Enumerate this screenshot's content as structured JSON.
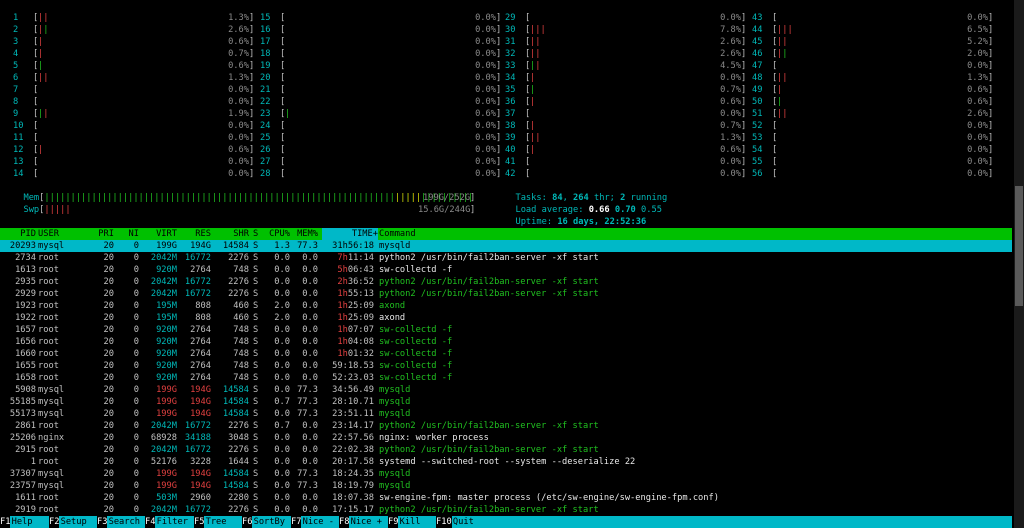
{
  "cpus": [
    {
      "n": "1",
      "bars": [
        [
          "r",
          "||"
        ]
      ],
      "pct": "1.3%"
    },
    {
      "n": "2",
      "bars": [
        [
          "r",
          "|"
        ],
        [
          "g",
          "|"
        ]
      ],
      "pct": "2.6%"
    },
    {
      "n": "3",
      "bars": [
        [
          "r",
          "|"
        ]
      ],
      "pct": "0.6%"
    },
    {
      "n": "4",
      "bars": [
        [
          "r",
          "|"
        ]
      ],
      "pct": "0.7%"
    },
    {
      "n": "5",
      "bars": [
        [
          "g",
          "|"
        ]
      ],
      "pct": "0.6%"
    },
    {
      "n": "6",
      "bars": [
        [
          "r",
          "||"
        ]
      ],
      "pct": "1.3%"
    },
    {
      "n": "7",
      "bars": [],
      "pct": "0.0%"
    },
    {
      "n": "8",
      "bars": [],
      "pct": "0.0%"
    },
    {
      "n": "9",
      "bars": [
        [
          "g",
          "|"
        ],
        [
          "r",
          "|"
        ]
      ],
      "pct": "1.9%"
    },
    {
      "n": "10",
      "bars": [],
      "pct": "0.0%"
    },
    {
      "n": "11",
      "bars": [],
      "pct": "0.0%"
    },
    {
      "n": "12",
      "bars": [
        [
          "r",
          "|"
        ]
      ],
      "pct": "0.6%"
    },
    {
      "n": "13",
      "bars": [],
      "pct": "0.0%"
    },
    {
      "n": "14",
      "bars": [],
      "pct": "0.0%"
    },
    {
      "n": "15",
      "bars": [],
      "pct": "0.0%"
    },
    {
      "n": "16",
      "bars": [],
      "pct": "0.0%"
    },
    {
      "n": "17",
      "bars": [],
      "pct": "0.0%"
    },
    {
      "n": "18",
      "bars": [],
      "pct": "0.0%"
    },
    {
      "n": "19",
      "bars": [],
      "pct": "0.0%"
    },
    {
      "n": "20",
      "bars": [],
      "pct": "0.0%"
    },
    {
      "n": "21",
      "bars": [],
      "pct": "0.0%"
    },
    {
      "n": "22",
      "bars": [],
      "pct": "0.0%"
    },
    {
      "n": "23",
      "bars": [
        [
          "g",
          "|"
        ]
      ],
      "pct": "0.6%"
    },
    {
      "n": "24",
      "bars": [],
      "pct": "0.0%"
    },
    {
      "n": "25",
      "bars": [],
      "pct": "0.0%"
    },
    {
      "n": "26",
      "bars": [],
      "pct": "0.0%"
    },
    {
      "n": "27",
      "bars": [],
      "pct": "0.0%"
    },
    {
      "n": "28",
      "bars": [],
      "pct": "0.0%"
    },
    {
      "n": "29",
      "bars": [],
      "pct": "0.0%"
    },
    {
      "n": "30",
      "bars": [
        [
          "r",
          "|||"
        ]
      ],
      "pct": "7.8%"
    },
    {
      "n": "31",
      "bars": [
        [
          "r",
          "||"
        ]
      ],
      "pct": "2.6%"
    },
    {
      "n": "32",
      "bars": [
        [
          "r",
          "||"
        ]
      ],
      "pct": "2.6%"
    },
    {
      "n": "33",
      "bars": [
        [
          "g",
          "|"
        ],
        [
          "r",
          "|"
        ]
      ],
      "pct": "4.5%"
    },
    {
      "n": "34",
      "bars": [
        [
          "r",
          "|"
        ]
      ],
      "pct": "0.0%"
    },
    {
      "n": "35",
      "bars": [
        [
          "g",
          "|"
        ]
      ],
      "pct": "0.7%"
    },
    {
      "n": "36",
      "bars": [
        [
          "r",
          "|"
        ]
      ],
      "pct": "0.6%"
    },
    {
      "n": "37",
      "bars": [],
      "pct": "0.0%"
    },
    {
      "n": "38",
      "bars": [
        [
          "r",
          "|"
        ]
      ],
      "pct": "0.7%"
    },
    {
      "n": "39",
      "bars": [
        [
          "r",
          "||"
        ]
      ],
      "pct": "1.3%"
    },
    {
      "n": "40",
      "bars": [
        [
          "r",
          "|"
        ]
      ],
      "pct": "0.6%"
    },
    {
      "n": "41",
      "bars": [],
      "pct": "0.0%"
    },
    {
      "n": "42",
      "bars": [],
      "pct": "0.0%"
    },
    {
      "n": "43",
      "bars": [],
      "pct": "0.0%"
    },
    {
      "n": "44",
      "bars": [
        [
          "r",
          "|||"
        ]
      ],
      "pct": "6.5%"
    },
    {
      "n": "45",
      "bars": [
        [
          "r",
          "||"
        ]
      ],
      "pct": "5.2%"
    },
    {
      "n": "46",
      "bars": [
        [
          "r",
          "|"
        ],
        [
          "g",
          "|"
        ]
      ],
      "pct": "2.0%"
    },
    {
      "n": "47",
      "bars": [],
      "pct": "0.0%"
    },
    {
      "n": "48",
      "bars": [
        [
          "r",
          "||"
        ]
      ],
      "pct": "1.3%"
    },
    {
      "n": "49",
      "bars": [
        [
          "r",
          "|"
        ]
      ],
      "pct": "0.6%"
    },
    {
      "n": "50",
      "bars": [
        [
          "g",
          "|"
        ]
      ],
      "pct": "0.6%"
    },
    {
      "n": "51",
      "bars": [
        [
          "r",
          "||"
        ]
      ],
      "pct": "2.6%"
    },
    {
      "n": "52",
      "bars": [],
      "pct": "0.0%"
    },
    {
      "n": "53",
      "bars": [],
      "pct": "0.0%"
    },
    {
      "n": "54",
      "bars": [],
      "pct": "0.0%"
    },
    {
      "n": "55",
      "bars": [],
      "pct": "0.0%"
    },
    {
      "n": "56",
      "bars": [],
      "pct": "0.0%"
    }
  ],
  "memory": {
    "mem_label": "Mem",
    "mem_bar": "||||||||||||||||||||||||||||||||||||||||||||||||||||||||||||||||||||||||||||||||||",
    "mem_tail": "|||||",
    "mem_value": "199G/252G",
    "swp_label": "Swp",
    "swp_bar": "|||||",
    "swp_value": "15.6G/244G"
  },
  "summary": {
    "tasks_label": "Tasks: ",
    "tasks_count": "84",
    "thr_sep": ", ",
    "thr_count": "264",
    "thr_label": " thr; ",
    "running_count": "2",
    "running_label": " running",
    "load_label": "Load average: ",
    "load1": "0.66",
    "load5": "0.70",
    "load15": "0.55",
    "uptime_label": "Uptime: ",
    "uptime": "16 days, 22:52:36"
  },
  "header": {
    "pid": "PID",
    "user": "USER",
    "pri": "PRI",
    "ni": "NI",
    "virt": "VIRT",
    "res": "RES",
    "shr": "SHR",
    "s": "S",
    "cpu": "CPU%",
    "mem": "MEM%",
    "time": "TIME+",
    "cmd": "Command"
  },
  "processes": [
    {
      "pid": "20293",
      "user": "mysql",
      "pri": "20",
      "ni": "0",
      "virt": "199G",
      "res": "194G",
      "shr": "14584",
      "s": "S",
      "cpu": "1.3",
      "mem": "77.3",
      "time": "31h56:18",
      "cmd": "mysqld",
      "sel": true
    },
    {
      "pid": "2734",
      "user": "root",
      "pri": "20",
      "ni": "0",
      "virt": "2042M",
      "res": "16772",
      "shr": "2276",
      "s": "S",
      "cpu": "0.0",
      "mem": "0.0",
      "time": "7h11:14",
      "cmd": "python2 /usr/bin/fail2ban-server -xf start"
    },
    {
      "pid": "1613",
      "user": "root",
      "pri": "20",
      "ni": "0",
      "virt": "920M",
      "res": "2764",
      "shr": "748",
      "s": "S",
      "cpu": "0.0",
      "mem": "0.0",
      "time": "5h06:43",
      "cmd": "sw-collectd -f"
    },
    {
      "pid": "2935",
      "user": "root",
      "pri": "20",
      "ni": "0",
      "virt": "2042M",
      "res": "16772",
      "shr": "2276",
      "s": "S",
      "cpu": "0.0",
      "mem": "0.0",
      "time": "2h36:52",
      "cmd": "python2 /usr/bin/fail2ban-server -xf start",
      "thread": true
    },
    {
      "pid": "2929",
      "user": "root",
      "pri": "20",
      "ni": "0",
      "virt": "2042M",
      "res": "16772",
      "shr": "2276",
      "s": "S",
      "cpu": "0.0",
      "mem": "0.0",
      "time": "1h55:13",
      "cmd": "python2 /usr/bin/fail2ban-server -xf start",
      "thread": true
    },
    {
      "pid": "1923",
      "user": "root",
      "pri": "20",
      "ni": "0",
      "virt": "195M",
      "res": "808",
      "shr": "460",
      "s": "S",
      "cpu": "2.0",
      "mem": "0.0",
      "time": "1h25:09",
      "cmd": "axond",
      "thread": true
    },
    {
      "pid": "1922",
      "user": "root",
      "pri": "20",
      "ni": "0",
      "virt": "195M",
      "res": "808",
      "shr": "460",
      "s": "S",
      "cpu": "2.0",
      "mem": "0.0",
      "time": "1h25:09",
      "cmd": "axond"
    },
    {
      "pid": "1657",
      "user": "root",
      "pri": "20",
      "ni": "0",
      "virt": "920M",
      "res": "2764",
      "shr": "748",
      "s": "S",
      "cpu": "0.0",
      "mem": "0.0",
      "time": "1h07:07",
      "cmd": "sw-collectd -f",
      "thread": true
    },
    {
      "pid": "1656",
      "user": "root",
      "pri": "20",
      "ni": "0",
      "virt": "920M",
      "res": "2764",
      "shr": "748",
      "s": "S",
      "cpu": "0.0",
      "mem": "0.0",
      "time": "1h04:08",
      "cmd": "sw-collectd -f",
      "thread": true
    },
    {
      "pid": "1660",
      "user": "root",
      "pri": "20",
      "ni": "0",
      "virt": "920M",
      "res": "2764",
      "shr": "748",
      "s": "S",
      "cpu": "0.0",
      "mem": "0.0",
      "time": "1h01:32",
      "cmd": "sw-collectd -f",
      "thread": true
    },
    {
      "pid": "1655",
      "user": "root",
      "pri": "20",
      "ni": "0",
      "virt": "920M",
      "res": "2764",
      "shr": "748",
      "s": "S",
      "cpu": "0.0",
      "mem": "0.0",
      "time": "59:18.53",
      "cmd": "sw-collectd -f",
      "thread": true
    },
    {
      "pid": "1658",
      "user": "root",
      "pri": "20",
      "ni": "0",
      "virt": "920M",
      "res": "2764",
      "shr": "748",
      "s": "S",
      "cpu": "0.0",
      "mem": "0.0",
      "time": "52:23.03",
      "cmd": "sw-collectd -f",
      "thread": true
    },
    {
      "pid": "5908",
      "user": "mysql",
      "pri": "20",
      "ni": "0",
      "virt": "199G",
      "res": "194G",
      "shr": "14584",
      "s": "S",
      "cpu": "0.0",
      "mem": "77.3",
      "time": "34:56.49",
      "cmd": "mysqld",
      "thread": true,
      "big": true
    },
    {
      "pid": "55185",
      "user": "mysql",
      "pri": "20",
      "ni": "0",
      "virt": "199G",
      "res": "194G",
      "shr": "14584",
      "s": "S",
      "cpu": "0.7",
      "mem": "77.3",
      "time": "28:10.71",
      "cmd": "mysqld",
      "thread": true,
      "big": true
    },
    {
      "pid": "55173",
      "user": "mysql",
      "pri": "20",
      "ni": "0",
      "virt": "199G",
      "res": "194G",
      "shr": "14584",
      "s": "S",
      "cpu": "0.0",
      "mem": "77.3",
      "time": "23:51.11",
      "cmd": "mysqld",
      "thread": true,
      "big": true
    },
    {
      "pid": "2861",
      "user": "root",
      "pri": "20",
      "ni": "0",
      "virt": "2042M",
      "res": "16772",
      "shr": "2276",
      "s": "S",
      "cpu": "0.7",
      "mem": "0.0",
      "time": "23:14.17",
      "cmd": "python2 /usr/bin/fail2ban-server -xf start",
      "thread": true
    },
    {
      "pid": "25206",
      "user": "nginx",
      "pri": "20",
      "ni": "0",
      "virt": "68928",
      "res": "34188",
      "shr": "3048",
      "s": "S",
      "cpu": "0.0",
      "mem": "0.0",
      "time": "22:57.56",
      "cmd": "nginx: worker process"
    },
    {
      "pid": "2915",
      "user": "root",
      "pri": "20",
      "ni": "0",
      "virt": "2042M",
      "res": "16772",
      "shr": "2276",
      "s": "S",
      "cpu": "0.0",
      "mem": "0.0",
      "time": "22:02.38",
      "cmd": "python2 /usr/bin/fail2ban-server -xf start",
      "thread": true
    },
    {
      "pid": "1",
      "user": "root",
      "pri": "20",
      "ni": "0",
      "virt": "52176",
      "res": "3228",
      "shr": "1644",
      "s": "S",
      "cpu": "0.0",
      "mem": "0.0",
      "time": "20:17.58",
      "cmd": "systemd --switched-root --system --deserialize 22"
    },
    {
      "pid": "37307",
      "user": "mysql",
      "pri": "20",
      "ni": "0",
      "virt": "199G",
      "res": "194G",
      "shr": "14584",
      "s": "S",
      "cpu": "0.0",
      "mem": "77.3",
      "time": "18:24.35",
      "cmd": "mysqld",
      "thread": true,
      "big": true
    },
    {
      "pid": "23757",
      "user": "mysql",
      "pri": "20",
      "ni": "0",
      "virt": "199G",
      "res": "194G",
      "shr": "14584",
      "s": "S",
      "cpu": "0.0",
      "mem": "77.3",
      "time": "18:19.79",
      "cmd": "mysqld",
      "thread": true,
      "big": true
    },
    {
      "pid": "1611",
      "user": "root",
      "pri": "20",
      "ni": "0",
      "virt": "503M",
      "res": "2960",
      "shr": "2280",
      "s": "S",
      "cpu": "0.0",
      "mem": "0.0",
      "time": "18:07.38",
      "cmd": "sw-engine-fpm: master process (/etc/sw-engine/sw-engine-fpm.conf)"
    },
    {
      "pid": "2919",
      "user": "root",
      "pri": "20",
      "ni": "0",
      "virt": "2042M",
      "res": "16772",
      "shr": "2276",
      "s": "S",
      "cpu": "0.0",
      "mem": "0.0",
      "time": "17:15.17",
      "cmd": "python2 /usr/bin/fail2ban-server -xf start",
      "thread": true
    }
  ],
  "footer": [
    {
      "key": "F1",
      "label": "Help"
    },
    {
      "key": "F2",
      "label": "Setup"
    },
    {
      "key": "F3",
      "label": "Search"
    },
    {
      "key": "F4",
      "label": "Filter"
    },
    {
      "key": "F5",
      "label": "Tree"
    },
    {
      "key": "F6",
      "label": "SortBy"
    },
    {
      "key": "F7",
      "label": "Nice -"
    },
    {
      "key": "F8",
      "label": "Nice +"
    },
    {
      "key": "F9",
      "label": "Kill"
    },
    {
      "key": "F10",
      "label": "Quit"
    }
  ],
  "colors": {
    "cyan": "#00b8b8",
    "green": "#00c000",
    "selected": "#00b8c8",
    "red": "#e04040"
  }
}
